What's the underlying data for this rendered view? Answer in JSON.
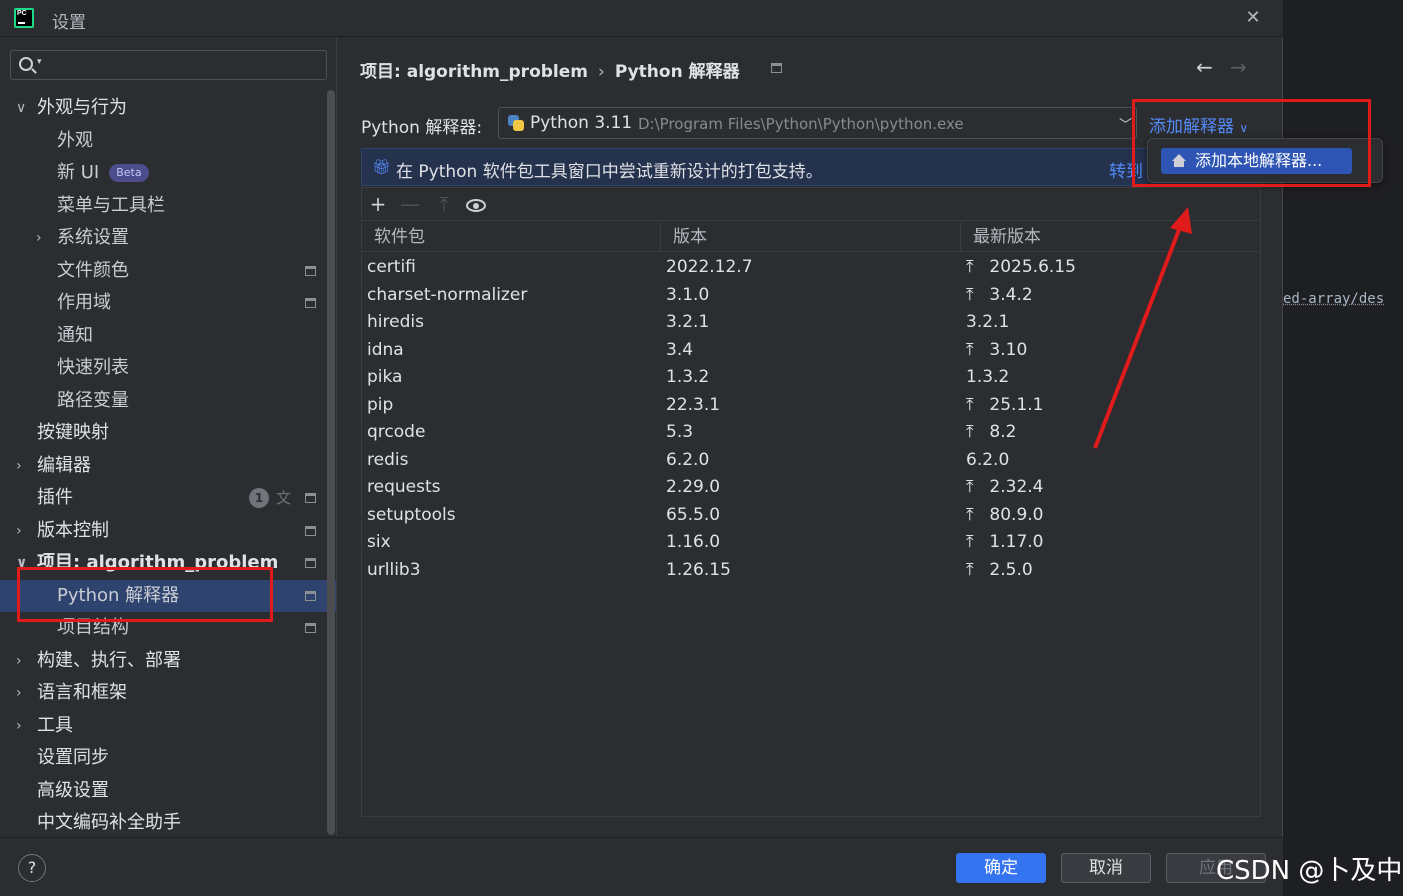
{
  "window": {
    "title": "设置"
  },
  "search": {
    "placeholder": ""
  },
  "sidebar": {
    "items": [
      {
        "label": "外观与行为",
        "level": 1,
        "expand": "open"
      },
      {
        "label": "外观",
        "level": 2
      },
      {
        "label": "新 UI",
        "level": 2,
        "badge": "Beta"
      },
      {
        "label": "菜单与工具栏",
        "level": 2
      },
      {
        "label": "系统设置",
        "level": 2,
        "expand": "closed"
      },
      {
        "label": "文件颜色",
        "level": 2,
        "icon": true
      },
      {
        "label": "作用域",
        "level": 2,
        "icon": true
      },
      {
        "label": "通知",
        "level": 2
      },
      {
        "label": "快速列表",
        "level": 2
      },
      {
        "label": "路径变量",
        "level": 2
      },
      {
        "label": "按键映射",
        "level": 1
      },
      {
        "label": "编辑器",
        "level": 1,
        "expand": "closed"
      },
      {
        "label": "插件",
        "level": 1,
        "count": "1",
        "icon": true
      },
      {
        "label": "版本控制",
        "level": 1,
        "expand": "closed",
        "icon": true
      },
      {
        "label": "项目: algorithm_problem",
        "level": 1,
        "expand": "open",
        "icon": true,
        "bold": true
      },
      {
        "label": "Python 解释器",
        "level": 2,
        "icon": true,
        "selected": true
      },
      {
        "label": "项目结构",
        "level": 2,
        "icon": true
      },
      {
        "label": "构建、执行、部署",
        "level": 1,
        "expand": "closed"
      },
      {
        "label": "语言和框架",
        "level": 1,
        "expand": "closed"
      },
      {
        "label": "工具",
        "level": 1,
        "expand": "closed"
      },
      {
        "label": "设置同步",
        "level": 1
      },
      {
        "label": "高级设置",
        "level": 1
      },
      {
        "label": "中文编码补全助手",
        "level": 1
      }
    ]
  },
  "breadcrumb": {
    "project": "项目: algorithm_problem",
    "page": "Python 解释器"
  },
  "interpreter": {
    "label": "Python 解释器:",
    "name": "Python 3.11",
    "path": "D:\\Program Files\\Python\\Python\\python.exe",
    "add_label": "添加解释器"
  },
  "banner": {
    "text": "在 Python 软件包工具窗口中尝试重新设计的打包支持。",
    "link": "转到"
  },
  "packages": {
    "columns": [
      "软件包",
      "版本",
      "最新版本"
    ],
    "rows": [
      {
        "name": "certifi",
        "version": "2022.12.7",
        "latest": "2025.6.15",
        "upgrade": true
      },
      {
        "name": "charset-normalizer",
        "version": "3.1.0",
        "latest": "3.4.2",
        "upgrade": true
      },
      {
        "name": "hiredis",
        "version": "3.2.1",
        "latest": "3.2.1",
        "upgrade": false
      },
      {
        "name": "idna",
        "version": "3.4",
        "latest": "3.10",
        "upgrade": true
      },
      {
        "name": "pika",
        "version": "1.3.2",
        "latest": "1.3.2",
        "upgrade": false
      },
      {
        "name": "pip",
        "version": "22.3.1",
        "latest": "25.1.1",
        "upgrade": true
      },
      {
        "name": "qrcode",
        "version": "5.3",
        "latest": "8.2",
        "upgrade": true
      },
      {
        "name": "redis",
        "version": "6.2.0",
        "latest": "6.2.0",
        "upgrade": false
      },
      {
        "name": "requests",
        "version": "2.29.0",
        "latest": "2.32.4",
        "upgrade": true
      },
      {
        "name": "setuptools",
        "version": "65.5.0",
        "latest": "80.9.0",
        "upgrade": true
      },
      {
        "name": "six",
        "version": "1.16.0",
        "latest": "1.17.0",
        "upgrade": true
      },
      {
        "name": "urllib3",
        "version": "1.26.15",
        "latest": "2.5.0",
        "upgrade": true
      }
    ]
  },
  "popup": {
    "item": "添加本地解释器..."
  },
  "footer": {
    "ok": "确定",
    "cancel": "取消",
    "apply": "应用"
  },
  "background": {
    "editor_text": "ed-array/des"
  },
  "watermark": "CSDN @卜及中",
  "colors": {
    "accent": "#3574f0",
    "selection": "#2e436e",
    "annotation": "#e01b1b",
    "link": "#548af7"
  }
}
